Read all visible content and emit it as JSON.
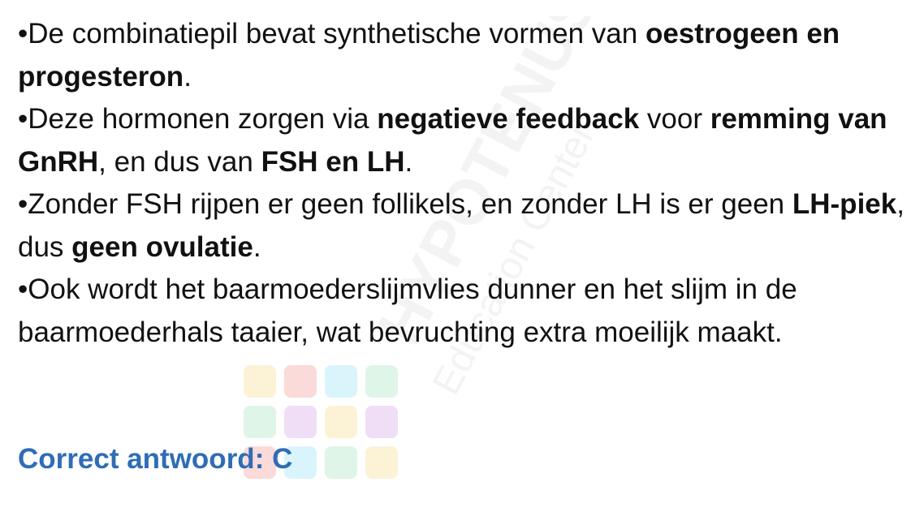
{
  "bullets": [
    {
      "marker": "•",
      "segments": [
        {
          "text": "De combinatiepil bevat synthetische vormen van ",
          "bold": false
        },
        {
          "text": "oestrogeen en progesteron",
          "bold": true
        },
        {
          "text": ".",
          "bold": false
        }
      ]
    },
    {
      "marker": "•",
      "segments": [
        {
          "text": "Deze hormonen zorgen via ",
          "bold": false
        },
        {
          "text": "negatieve feedback",
          "bold": true
        },
        {
          "text": " voor ",
          "bold": false
        },
        {
          "text": "remming van GnRH",
          "bold": true
        },
        {
          "text": ", en dus van ",
          "bold": false
        },
        {
          "text": "FSH en LH",
          "bold": true
        },
        {
          "text": ".",
          "bold": false
        }
      ]
    },
    {
      "marker": "•",
      "segments": [
        {
          "text": "Zonder FSH rijpen er geen follikels, en zonder LH is er geen ",
          "bold": false
        },
        {
          "text": "LH-piek",
          "bold": true
        },
        {
          "text": ", dus ",
          "bold": false
        },
        {
          "text": "geen ovulatie",
          "bold": true
        },
        {
          "text": ".",
          "bold": false
        }
      ]
    },
    {
      "marker": "•",
      "segments": [
        {
          "text": "Ook wordt het baarmoederslijmvlies dunner en het slijm in de baarmoederhals taaier, wat bevruchting extra moeilijk maakt.",
          "bold": false
        }
      ]
    }
  ],
  "answer": {
    "text": "Correct antwoord: C",
    "color": "#2f6db5"
  },
  "watermark": {
    "brand": "HYPOTENUSE",
    "tagline": "Education Center",
    "logo_colors": [
      "#f2c94c",
      "#eb5757",
      "#56ccf2",
      "#6fcf97",
      "#bb6bd9"
    ],
    "text_color": "#c8c8c8"
  }
}
